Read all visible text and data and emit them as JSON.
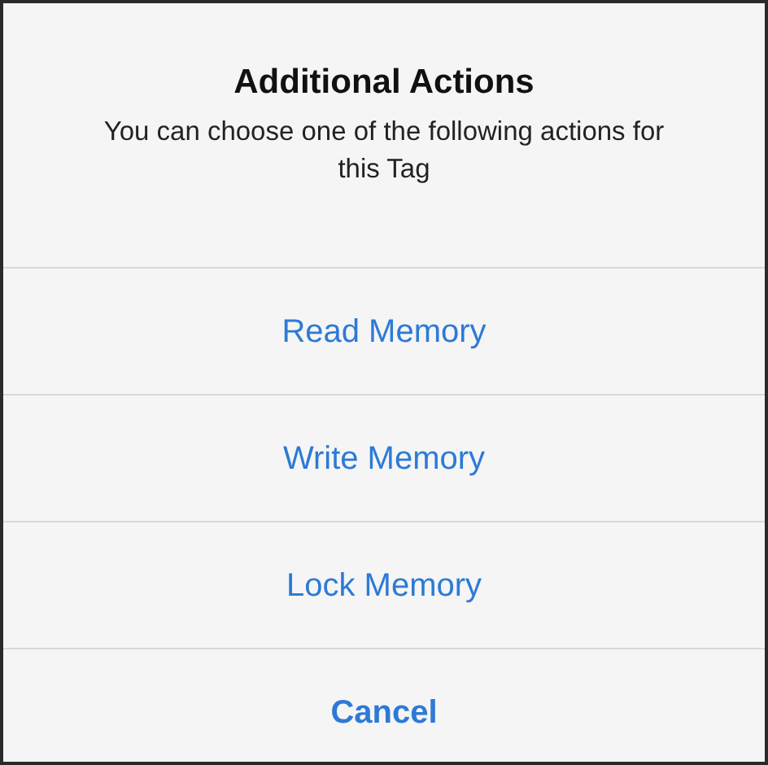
{
  "sheet": {
    "title": "Additional Actions",
    "message": "You can choose one of the following actions for this Tag",
    "actions": [
      {
        "label": "Read Memory",
        "kind": "default"
      },
      {
        "label": "Write Memory",
        "kind": "default"
      },
      {
        "label": "Lock Memory",
        "kind": "default"
      },
      {
        "label": "Cancel",
        "kind": "cancel"
      }
    ]
  }
}
